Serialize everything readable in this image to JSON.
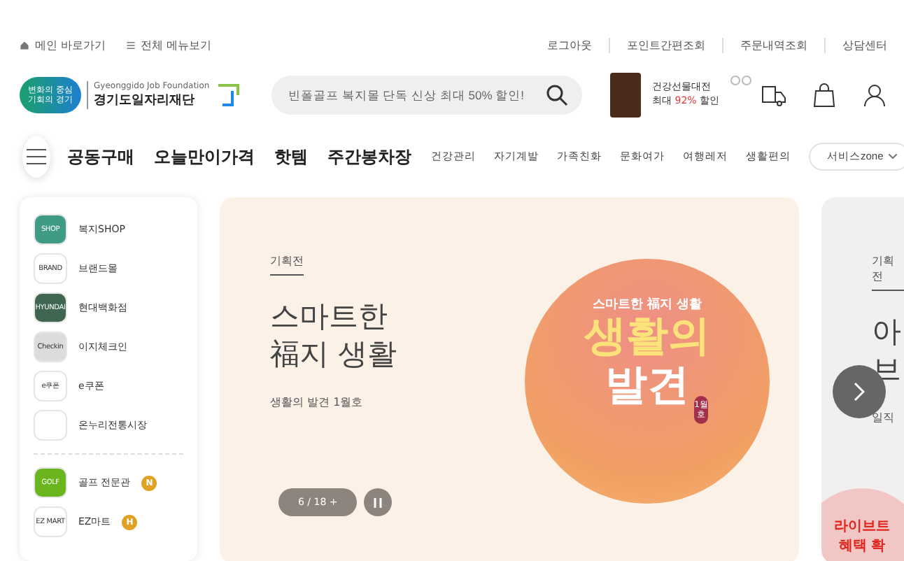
{
  "top_links": {
    "left": [
      "메인 바로가기",
      "전체 메뉴보기"
    ],
    "right": [
      "로그아웃",
      "포인트간편조회",
      "주문내역조회",
      "상담센터"
    ]
  },
  "logo": {
    "badge_lines": [
      "변화의 중심",
      "기회의 경기"
    ],
    "sub": "Gyeonggido Job Foundation",
    "name": "경기도일자리재단"
  },
  "search": {
    "placeholder": "빈폴골프 복지몰 단독 신상 최대 50% 할인!"
  },
  "promo": {
    "title": "건강선물대전",
    "prefix": "최대 ",
    "highlight": "92%",
    "suffix": " 할인"
  },
  "main_nav": [
    "공동구매",
    "오늘만이가격",
    "핫템",
    "주간봉차장"
  ],
  "categories": [
    "건강관리",
    "자기계발",
    "가족친화",
    "문화여가",
    "여행레저",
    "생활편의"
  ],
  "service_select": {
    "value": "서비스zone"
  },
  "sidebar": [
    {
      "label": "복지SHOP",
      "icon_text": "SHOP",
      "color": "#3f9a86"
    },
    {
      "label": "브랜드몰",
      "icon_text": "BRAND",
      "color": "#ffffff"
    },
    {
      "label": "현대백화점",
      "icon_text": "HYUNDAI",
      "color": "#3f6650"
    },
    {
      "label": "이지체크인",
      "icon_text": "Checkin",
      "color": "#dcdcdc"
    },
    {
      "label": "e쿠폰",
      "icon_text": "e쿠폰",
      "color": "#ffffff"
    },
    {
      "label": "온누리전통시장",
      "color": "#ffffff"
    },
    {
      "label": "골프 전문관",
      "icon_text": "GOLF",
      "color": "#6ab41e",
      "badge": "N",
      "divider_before": true
    },
    {
      "label": "EZ마트",
      "icon_text": "EZ MART",
      "color": "#ffffff",
      "badge": "H"
    }
  ],
  "banner": {
    "tag": "기획전",
    "title_lines": [
      "스마트한",
      "福지 생활"
    ],
    "subtitle": "생활의 발견 1월호",
    "counter": "6 / 18 +",
    "art": {
      "top": "스마트한 福지 생활",
      "big": [
        "생활의",
        "발견"
      ],
      "issue": "1월호"
    }
  },
  "next_card": {
    "tag": "기획전",
    "title_lines": [
      "아",
      "브"
    ],
    "subtitle": "일직",
    "sticker": [
      "라이브트",
      "혜택 확"
    ]
  }
}
